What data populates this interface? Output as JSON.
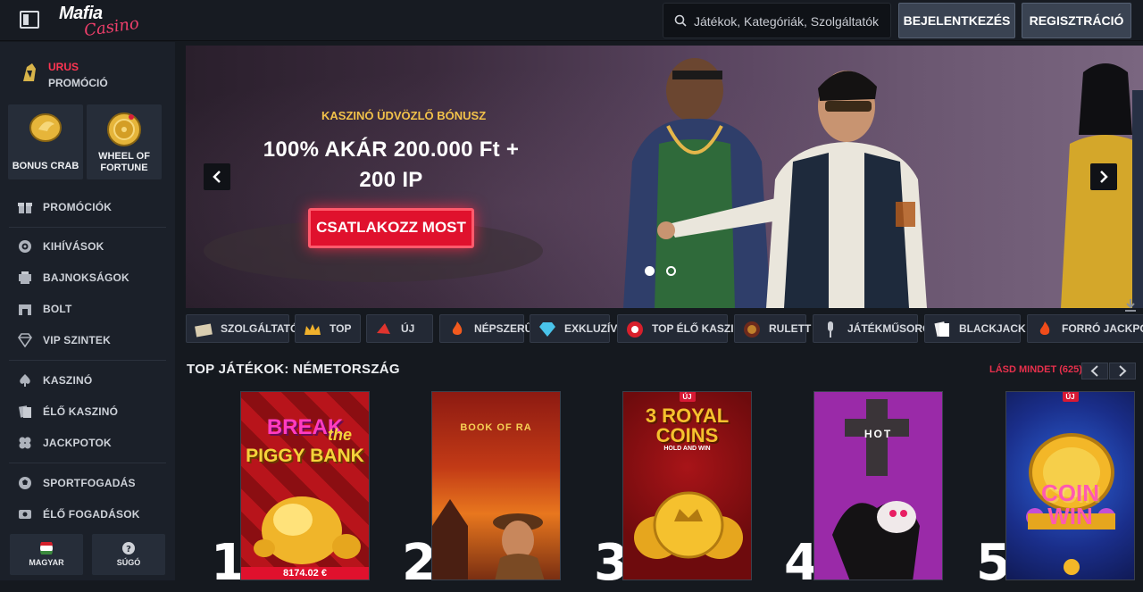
{
  "header": {
    "logo_top": "Mafia",
    "logo_bottom": "Casino",
    "search_placeholder": "Játékok, Kategóriák, Szolgáltatók",
    "login": "BEJELENTKEZÉS",
    "register": "REGISZTRÁCIÓ"
  },
  "sidebar": {
    "promo_title": "URUS",
    "promo_sub": "PROMÓCIÓ",
    "tiles": [
      {
        "label": "BONUS CRAB"
      },
      {
        "label": "WHEEL OF FORTUNE"
      }
    ],
    "items": [
      {
        "label": "PROMÓCIÓK",
        "icon": "gift-icon"
      },
      {
        "label": "KIHÍVÁSOK",
        "icon": "target-icon"
      },
      {
        "label": "BAJNOKSÁGOK",
        "icon": "trophy-icon"
      },
      {
        "label": "BOLT",
        "icon": "shop-icon"
      },
      {
        "label": "VIP SZINTEK",
        "icon": "diamond-icon"
      },
      {
        "label": "KASZINÓ",
        "icon": "spade-icon"
      },
      {
        "label": "ÉLŐ KASZINÓ",
        "icon": "cards-icon"
      },
      {
        "label": "JACKPOTOK",
        "icon": "clover-icon"
      },
      {
        "label": "SPORTFOGADÁS",
        "icon": "ball-icon"
      },
      {
        "label": "ÉLŐ FOGADÁSOK",
        "icon": "live-icon"
      }
    ],
    "language": "MAGYAR",
    "help": "SÚGÓ"
  },
  "hero": {
    "subtitle": "KASZINÓ ÜDVÖZLŐ BÓNUSZ",
    "headline": "100% AKÁR 200.000 Ft + 200 IP",
    "cta": "CSATLAKOZZ MOST"
  },
  "categories": [
    {
      "label": "SZOLGÁLTATÓK",
      "icon": "box-icon"
    },
    {
      "label": "TOP",
      "icon": "crown-icon"
    },
    {
      "label": "ÚJ",
      "icon": "horn-icon"
    },
    {
      "label": "NÉPSZERŰ",
      "icon": "fire-icon"
    },
    {
      "label": "EXKLUZÍV",
      "icon": "gem-icon"
    },
    {
      "label": "TOP ÉLŐ KASZINÓ",
      "icon": "chip-icon"
    },
    {
      "label": "RULETT",
      "icon": "roulette-icon"
    },
    {
      "label": "JÁTÉKMŰSOROK",
      "icon": "mic-icon"
    },
    {
      "label": "BLACKJACK",
      "icon": "cards-icon"
    },
    {
      "label": "FORRÓ JACKPOTOK",
      "icon": "flame-icon"
    }
  ],
  "top_games": {
    "title": "TOP JÁTÉKOK: NÉMETORSZÁG",
    "see_all": "LÁSD MINDET (625)",
    "new_badge": "ÚJ",
    "games": [
      {
        "rank": "1",
        "title_a": "BREAK",
        "title_b": "the",
        "title_c": "PIGGY BANK",
        "jackpot": "8174.02 €"
      },
      {
        "rank": "2",
        "title_a": "BOOK OF RA"
      },
      {
        "rank": "3",
        "title_a": "3 ROYAL",
        "title_b": "COINS",
        "title_c": "HOLD AND WIN"
      },
      {
        "rank": "4",
        "title_a": "HOT"
      },
      {
        "rank": "5",
        "title_a": "COIN",
        "title_b": "WIN"
      }
    ]
  }
}
